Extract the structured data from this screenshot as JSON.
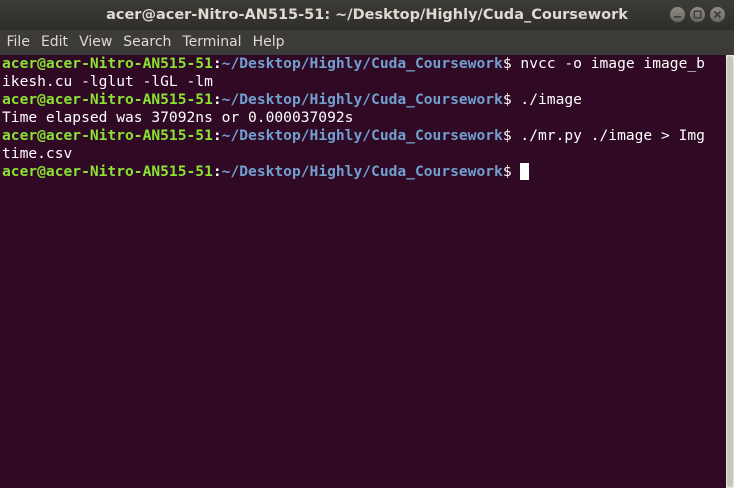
{
  "window": {
    "title": "acer@acer-Nitro-AN515-51: ~/Desktop/Highly/Cuda_Coursework"
  },
  "menu": {
    "items": [
      "File",
      "Edit",
      "View",
      "Search",
      "Terminal",
      "Help"
    ]
  },
  "prompt": {
    "user_host": "acer@acer-Nitro-AN515-51",
    "colon": ":",
    "path": "~/Desktop/Highly/Cuda_Coursework",
    "dollar": "$ "
  },
  "terminal": {
    "cmd1_a": "nvcc -o image image_b",
    "cmd1_b": "ikesh.cu -lglut -lGL -lm",
    "cmd2": "./image",
    "output1": "Time elapsed was 37092ns or 0.000037092s",
    "cmd3_a": "./mr.py ./image > Img",
    "cmd3_b": "time.csv"
  },
  "colors": {
    "background": "#300a24",
    "prompt_user": "#8ae234",
    "prompt_path": "#729fcf",
    "text": "#ffffff"
  }
}
